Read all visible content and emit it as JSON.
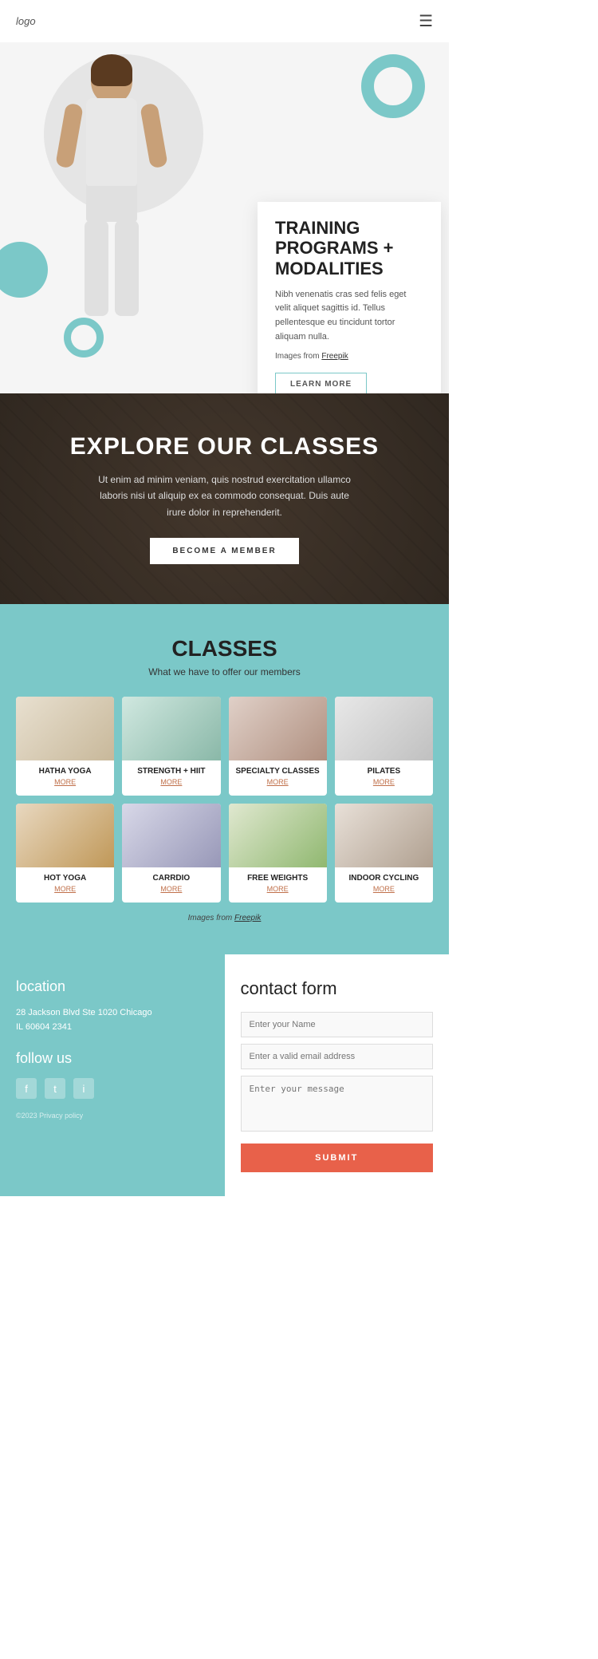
{
  "nav": {
    "logo": "logo",
    "menu_icon": "☰"
  },
  "hero": {
    "title_line1": "TRAINING",
    "title_line2": "PROGRAMS +",
    "title_line3": "MODALITIES",
    "description": "Nibh venenatis cras sed felis eget velit aliquet sagittis id. Tellus pellentesque eu tincidunt tortor aliquam nulla.",
    "images_credit": "Images from",
    "freepik_link": "Freepik",
    "learn_more": "LEARN MORE"
  },
  "explore": {
    "title": "EXPLORE OUR CLASSES",
    "description": "Ut enim ad minim veniam, quis nostrud exercitation ullamco laboris nisi ut aliquip ex ea commodo consequat. Duis aute irure dolor in reprehenderit.",
    "cta": "BECOME A MEMBER"
  },
  "classes": {
    "title": "CLASSES",
    "subtitle": "What we have to offer our members",
    "items": [
      {
        "name": "HATHA YOGA",
        "more": "MORE",
        "img_class": "img-hatha"
      },
      {
        "name": "STRENGTH + HIIT",
        "more": "MORE",
        "img_class": "img-strength"
      },
      {
        "name": "SPECIALTY CLASSES",
        "more": "MORE",
        "img_class": "img-specialty"
      },
      {
        "name": "PILATES",
        "more": "MORE",
        "img_class": "img-pilates"
      },
      {
        "name": "HOT YOGA",
        "more": "MORE",
        "img_class": "img-hotyoga"
      },
      {
        "name": "CARRDIO",
        "more": "MORE",
        "img_class": "img-cardio"
      },
      {
        "name": "FREE WEIGHTS",
        "more": "MORE",
        "img_class": "img-freeweights"
      },
      {
        "name": "INDOOR CYCLING",
        "more": "MORE",
        "img_class": "img-cycling"
      }
    ],
    "images_credit": "Images from",
    "freepik_link": "Freepik"
  },
  "footer": {
    "location": {
      "title": "location",
      "address_line1": "28 Jackson Blvd Ste 1020 Chicago",
      "address_line2": "IL 60604 2341"
    },
    "follow": {
      "title": "follow us",
      "icons": [
        "f",
        "t",
        "i"
      ],
      "copyright": "©2023 Privacy policy"
    },
    "contact": {
      "title": "contact form",
      "name_placeholder": "Enter your Name",
      "email_placeholder": "Enter a valid email address",
      "message_placeholder": "Enter your message",
      "submit": "SUBMIT"
    }
  }
}
